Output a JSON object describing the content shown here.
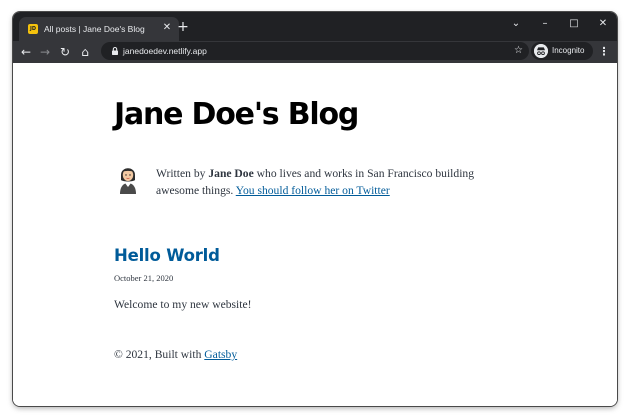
{
  "browser": {
    "tab": {
      "title": "All posts | Jane Doe's Blog",
      "favicon_text": "JD",
      "close_glyph": "✕"
    },
    "new_tab_glyph": "+",
    "window_controls": {
      "tabsearch": "⌄",
      "minimize": "–",
      "maximize": "□",
      "close": "✕"
    },
    "nav": {
      "back": "←",
      "forward": "→",
      "reload": "↻",
      "home": "⌂"
    },
    "url": "janedoedev.netlify.app",
    "star_glyph": "☆",
    "incognito_label": "Incognito",
    "menu_glyph": "⋮"
  },
  "blog": {
    "title": "Jane Doe's Blog",
    "bio": {
      "prefix": "Written by ",
      "author": "Jane Doe",
      "suffix": " who lives and works in San Francisco building awesome things. ",
      "follow_link": "You should follow her on Twitter"
    },
    "posts": [
      {
        "title": "Hello World",
        "date": "October 21, 2020",
        "excerpt": "Welcome to my new website!"
      }
    ],
    "footer": {
      "prefix": "© 2021, Built with ",
      "link": "Gatsby"
    }
  },
  "colors": {
    "link": "#005b99",
    "text": "#2e353f",
    "browser_dark": "#202124",
    "browser_toolbar": "#35363a"
  }
}
